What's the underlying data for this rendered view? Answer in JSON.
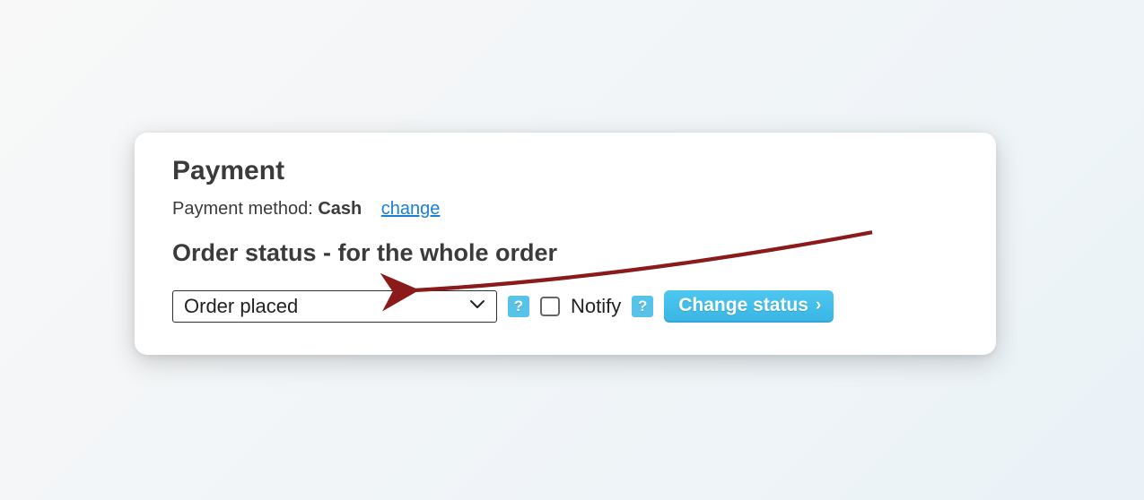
{
  "panel": {
    "title": "Payment",
    "payment_method_label": "Payment method: ",
    "payment_method_value": "Cash",
    "change_link": "change",
    "status_title": "Order status - for the whole order",
    "status_selected": "Order placed",
    "notify_label": "Notify",
    "help_badge": "?",
    "change_status_button": "Change status"
  }
}
